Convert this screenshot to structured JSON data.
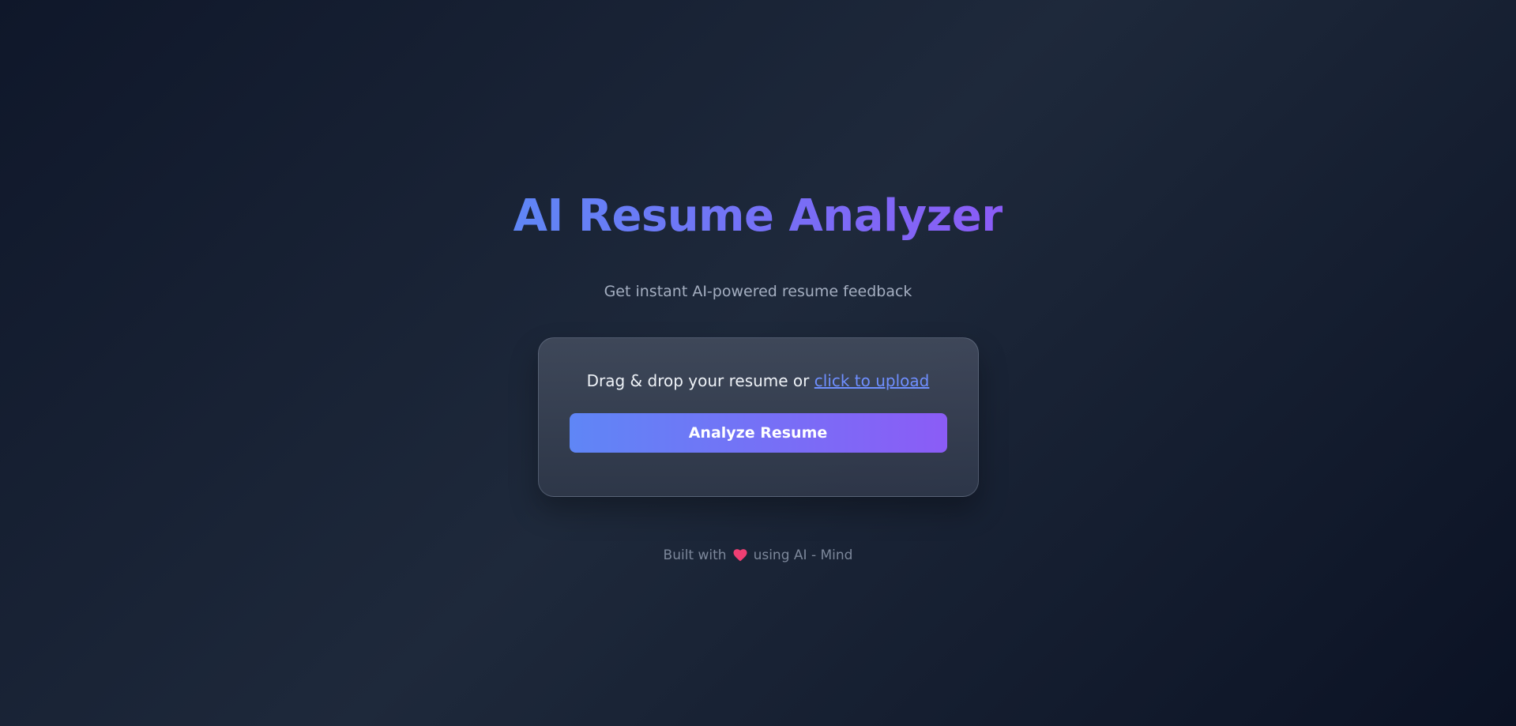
{
  "header": {
    "title": "AI Resume Analyzer",
    "subtitle": "Get instant AI-powered resume feedback"
  },
  "upload": {
    "prompt": "Drag & drop your resume or",
    "link_text": "click to upload"
  },
  "actions": {
    "analyze_label": "Analyze Resume"
  },
  "footer": {
    "before_icon": "Built with",
    "icon": "heart-icon",
    "after_icon": "using AI - Mind"
  },
  "colors": {
    "background": "#0f172a",
    "accent_start": "#5f86f6",
    "accent_end": "#8b5cf6",
    "card": "#374151",
    "link": "#6f8fff",
    "heart": "#ef3f73"
  }
}
